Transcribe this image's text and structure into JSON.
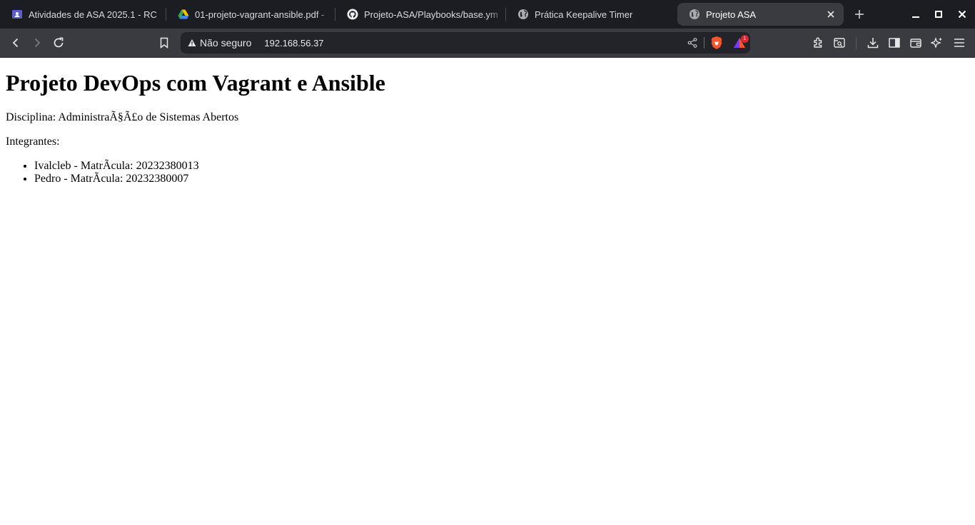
{
  "browser": {
    "tabs": [
      {
        "title": "Atividades de ASA 2025.1 - RC",
        "icon": "classroom-icon"
      },
      {
        "title": "01-projeto-vagrant-ansible.pdf -",
        "icon": "drive-icon"
      },
      {
        "title": "Projeto-ASA/Playbooks/base.yml",
        "icon": "github-icon"
      },
      {
        "title": "Prática Keepalive Timer",
        "icon": "globe-icon"
      },
      {
        "title": "Projeto ASA",
        "icon": "globe-icon",
        "active": true
      }
    ],
    "security_label": "Não seguro",
    "url": "192.168.56.37",
    "shields_badge": "1",
    "colors": {
      "tabstrip": "#1c1d22",
      "toolbar": "#3a3b41",
      "urlbar": "#23242a",
      "brave_orange": "#fb542b"
    }
  },
  "page": {
    "heading": "Projeto DevOps com Vagrant e Ansible",
    "discipline": "Disciplina: AdministraÃ§Ã£o de Sistemas Abertos",
    "members_label": "Integrantes:",
    "members": [
      "Ivalcleb - MatrÃcula: 20232380013",
      "Pedro - MatrÃcula: 20232380007"
    ]
  }
}
